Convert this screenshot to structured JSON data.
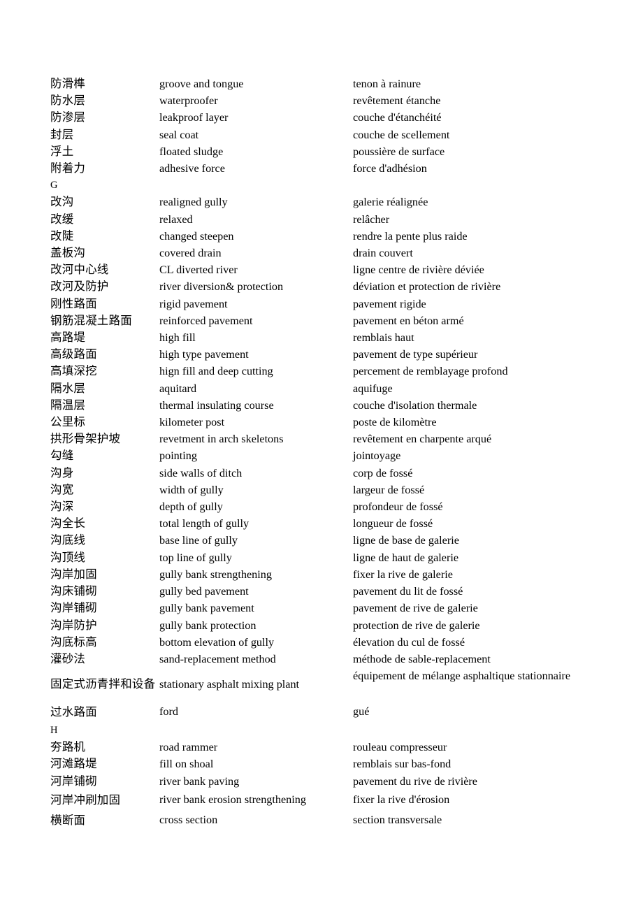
{
  "document": {
    "type": "trilingual-glossary",
    "columns": [
      "chinese",
      "english",
      "french"
    ],
    "page_background": "#ffffff",
    "text_color": "#000000"
  },
  "rows": [
    {
      "zh": "防滑榫",
      "en": "groove and tongue",
      "fr": "tenon à rainure"
    },
    {
      "zh": "防水层",
      "en": "waterproofer",
      "fr": "revêtement étanche"
    },
    {
      "zh": "防渗层",
      "en": "leakproof layer",
      "fr": "couche d'étanchéité"
    },
    {
      "zh": "封层",
      "en": "seal coat",
      "fr": "couche de scellement"
    },
    {
      "zh": "浮土",
      "en": "floated sludge",
      "fr": "poussière de surface"
    },
    {
      "zh": "附着力",
      "en": "adhesive force",
      "fr": "force d'adhésion"
    },
    {
      "zh": "G",
      "en": "",
      "fr": "",
      "section": true
    },
    {
      "zh": "改沟",
      "en": "realigned gully",
      "fr": "galerie réalignée"
    },
    {
      "zh": "改缓",
      "en": "relaxed",
      "fr": "relâcher"
    },
    {
      "zh": "改陡",
      "en": "changed steepen",
      "fr": "rendre la pente plus raide"
    },
    {
      "zh": "盖板沟",
      "en": "covered drain",
      "fr": "drain couvert"
    },
    {
      "zh": "改河中心线",
      "en": "CL diverted river",
      "fr": "ligne centre de rivière déviée"
    },
    {
      "zh": "改河及防护",
      "en": "river diversion& protection",
      "fr": "déviation et protection de rivière"
    },
    {
      "zh": "刚性路面",
      "en": "rigid pavement",
      "fr": "pavement rigide"
    },
    {
      "zh": "钢筋混凝土路面",
      "en": "reinforced pavement",
      "fr": "pavement en béton armé"
    },
    {
      "zh": "高路堤",
      "en": "high fill",
      "fr": "remblais haut"
    },
    {
      "zh": "高级路面",
      "en": "high type pavement",
      "fr": "pavement de type supérieur"
    },
    {
      "zh": "高填深挖",
      "en": "hign fill and deep cutting",
      "fr": "percement de remblayage profond"
    },
    {
      "zh": "隔水层",
      "en": "aquitard",
      "fr": "aquifuge"
    },
    {
      "zh": "隔温层",
      "en": "thermal insulating course",
      "fr": "couche d'isolation thermale"
    },
    {
      "zh": "公里标",
      "en": "kilometer post",
      "fr": "poste de kilomètre"
    },
    {
      "zh": "拱形骨架护坡",
      "en": "revetment in arch skeletons",
      "fr": "revêtement en charpente arqué"
    },
    {
      "zh": "勾缝",
      "en": "pointing",
      "fr": "jointoyage"
    },
    {
      "zh": "沟身",
      "en": "side walls of ditch",
      "fr": "corp de fossé"
    },
    {
      "zh": "沟宽",
      "en": "width of gully",
      "fr": "largeur de fossé"
    },
    {
      "zh": "沟深",
      "en": "depth of gully",
      "fr": "profondeur de fossé"
    },
    {
      "zh": "沟全长",
      "en": "total length of gully",
      "fr": "longueur de fossé"
    },
    {
      "zh": "沟底线",
      "en": "base line of gully",
      "fr": "ligne de base de galerie"
    },
    {
      "zh": "沟顶线",
      "en": "top line of gully",
      "fr": "ligne de haut de galerie"
    },
    {
      "zh": "沟岸加固",
      "en": "gully bank strengthening",
      "fr": "fixer la rive de galerie"
    },
    {
      "zh": "沟床铺砌",
      "en": "gully bed pavement",
      "fr": "pavement du lit de fossé"
    },
    {
      "zh": "沟岸铺砌",
      "en": "gully bank pavement",
      "fr": "pavement de rive de galerie"
    },
    {
      "zh": "沟岸防护",
      "en": "gully bank protection",
      "fr": "protection de rive de galerie"
    },
    {
      "zh": "沟底标高",
      "en": "bottom elevation of gully",
      "fr": "élevation du cul de fossé"
    },
    {
      "zh": "灌砂法",
      "en": "sand-replacement method",
      "fr": "méthode de sable-replacement"
    },
    {
      "zh": "固定式沥青拌和设备",
      "en": "stationary asphalt mixing plant",
      "fr": "équipement de mélange asphaltique stationnaire",
      "tall": true
    },
    {
      "zh": "过水路面",
      "en": "ford",
      "fr": "gué",
      "loose": true
    },
    {
      "zh": "H",
      "en": "",
      "fr": "",
      "section": true
    },
    {
      "zh": "夯路机",
      "en": "road rammer",
      "fr": "rouleau compresseur"
    },
    {
      "zh": "河滩路堤",
      "en": "fill on shoal",
      "fr": "remblais sur bas-fond"
    },
    {
      "zh": "河岸铺砌",
      "en": "river bank paving",
      "fr": "pavement du rive de rivière"
    },
    {
      "zh": "河岸冲刷加固",
      "en": "river bank erosion strengthening",
      "fr": "fixer la rive d'érosion",
      "loose": true
    },
    {
      "zh": "横断面",
      "en": "cross section",
      "fr": "section transversale",
      "loose": true
    }
  ]
}
